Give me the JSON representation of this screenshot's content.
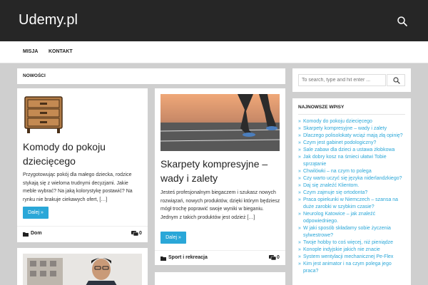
{
  "header": {
    "site_title": "Udemy.pl"
  },
  "nav": {
    "items": [
      "MISJA",
      "KONTAKT"
    ]
  },
  "main": {
    "section_title": "NOWOŚCI",
    "posts": [
      {
        "title": "Komody do pokoju dziecięcego",
        "excerpt": "Przygotowując pokój dla małego dziecka, rodzice stykają się z wieloma trudnymi decyzjami. Jakie meble wybrać? Na jaką kolorystykę postawić? Na rynku nie brakuje ciekawych ofert, […]",
        "read_more": "Dalej »",
        "category": "Dom",
        "comments": "0"
      },
      {
        "title": "Skarpety kompresyjne – wady i zalety",
        "excerpt": "Jesteś profesjonalnym biegaczem i szukasz nowych rozwiązań, nowych produktów, dzięki którym będziesz mógł trochę poprawić swoje wyniki w bieganiu. Jednym z takich produktów jest odzież […]",
        "read_more": "Dalej »",
        "category": "Sport i rekreacja",
        "comments": "0"
      }
    ]
  },
  "sidebar": {
    "search": {
      "placeholder": "To search, type and hit enter ..."
    },
    "recent": {
      "title": "NAJNOWSZE WPISY",
      "items": [
        "Komody do pokoju dziecięcego",
        "Skarpety kompresyjne – wady i zalety",
        "Dlaczego polisolokaty wciąż mają złą opinię?",
        "Czym jest gabinet podologiczny?",
        "Sale zabaw dla dzieci a ustawa żłobkowa",
        "Jak dobry kosz na śmieci ułatwi Tobie sprzątanie",
        "Chwilówki – na czym to polega",
        "Czy warto uczyć się języka niderlandzkiego?",
        "Daj się znaleźć Klientom.",
        "Czym zajmuje się ortodonta?",
        "Praca opiekunki w Niemczech – szansa na duże zarobki w szybkim czasie?",
        "Neurolog Katowice – jak znaleźć odpowiedniego.",
        "W jaki sposób składamy sobie życzenia sylwestrowe?",
        "Twoje hobby to coś więcej, niż pieniądze",
        "Konople indyjskie jakich nie znacie",
        "System wentylacji mechanicznej Pe-Flex",
        "Kim jest animator i na czym polega jego praca?"
      ]
    }
  },
  "colors": {
    "header_bg": "#262626",
    "accent": "#2aa7d8",
    "page_bg": "#cfcfcf"
  },
  "icons": {
    "search": "search-icon",
    "comments": "comment-icon",
    "category": "folder-icon"
  }
}
